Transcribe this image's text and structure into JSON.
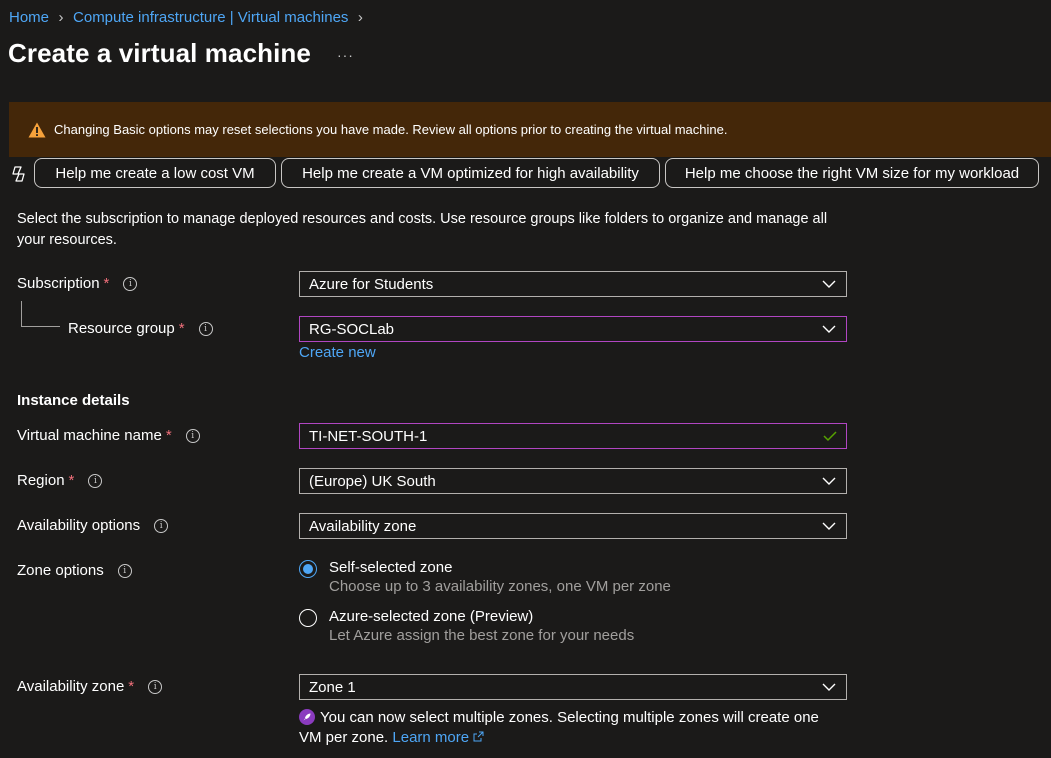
{
  "breadcrumb": {
    "home": "Home",
    "section": "Compute infrastructure | Virtual machines"
  },
  "page": {
    "title": "Create a virtual machine",
    "more": "···"
  },
  "warning": {
    "text": "Changing Basic options may reset selections you have made. Review all options prior to creating the virtual machine."
  },
  "help_buttons": {
    "low_cost": "Help me create a low cost VM",
    "high_availability": "Help me create a VM optimized for high availability",
    "vm_size": "Help me choose the right VM size for my workload"
  },
  "intro": "Select the subscription to manage deployed resources and costs. Use resource groups like folders to organize and manage all your resources.",
  "form": {
    "subscription": {
      "label": "Subscription",
      "value": "Azure for Students"
    },
    "resource_group": {
      "label": "Resource group",
      "value": "RG-SOCLab",
      "create_new": "Create new"
    },
    "instance_details": "Instance details",
    "vm_name": {
      "label": "Virtual machine name",
      "value": "TI-NET-SOUTH-1"
    },
    "region": {
      "label": "Region",
      "value": "(Europe) UK South"
    },
    "availability_options": {
      "label": "Availability options",
      "value": "Availability zone"
    },
    "zone_options": {
      "label": "Zone options",
      "self": {
        "title": "Self-selected zone",
        "desc": "Choose up to 3 availability zones, one VM per zone",
        "checked": true
      },
      "azure": {
        "title": "Azure-selected zone (Preview)",
        "desc": "Let Azure assign the best zone for your needs",
        "checked": false
      }
    },
    "availability_zone": {
      "label": "Availability zone",
      "value": "Zone 1"
    },
    "zone_note": "You can now select multiple zones. Selecting multiple zones will create one VM per zone.",
    "learn_more": "Learn more"
  },
  "required_mark": "*",
  "colors": {
    "background": "#1b1a19",
    "link": "#4ea6f5",
    "warning_bg": "#442709",
    "focus_border": "#b146c2",
    "required": "#f1707b"
  }
}
